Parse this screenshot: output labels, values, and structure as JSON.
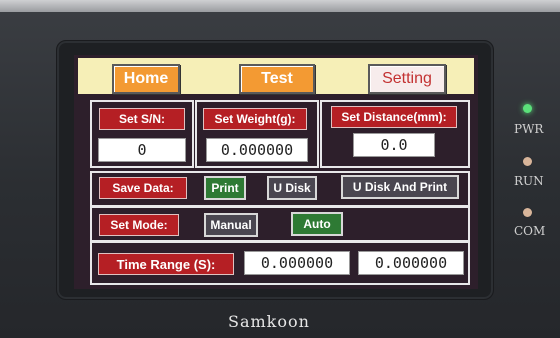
{
  "nav": {
    "home": "Home",
    "test": "Test",
    "setting": "Setting"
  },
  "settings": {
    "sn_label": "Set S/N:",
    "sn_value": "0",
    "weight_label": "Set Weight(g):",
    "weight_value": "0.000000",
    "distance_label": "Set Distance(mm):",
    "distance_value": "0.0"
  },
  "save_data": {
    "label": "Save Data:",
    "options": [
      "Print",
      "U Disk",
      "U Disk And Print"
    ]
  },
  "mode": {
    "label": "Set Mode:",
    "options": [
      "Manual",
      "Auto"
    ]
  },
  "time_range": {
    "label": "Time Range (S):",
    "from": "0.000000",
    "to": "0.000000"
  },
  "device": {
    "brand": "Samkoon",
    "indicators": [
      "PWR",
      "RUN",
      "COM"
    ]
  },
  "colors": {
    "accent_orange": "#f39a33",
    "label_red": "#b51f24",
    "option_green": "#2e7a34",
    "screen_bg": "#2d1f2b",
    "pwr_led": "#5be07a"
  }
}
